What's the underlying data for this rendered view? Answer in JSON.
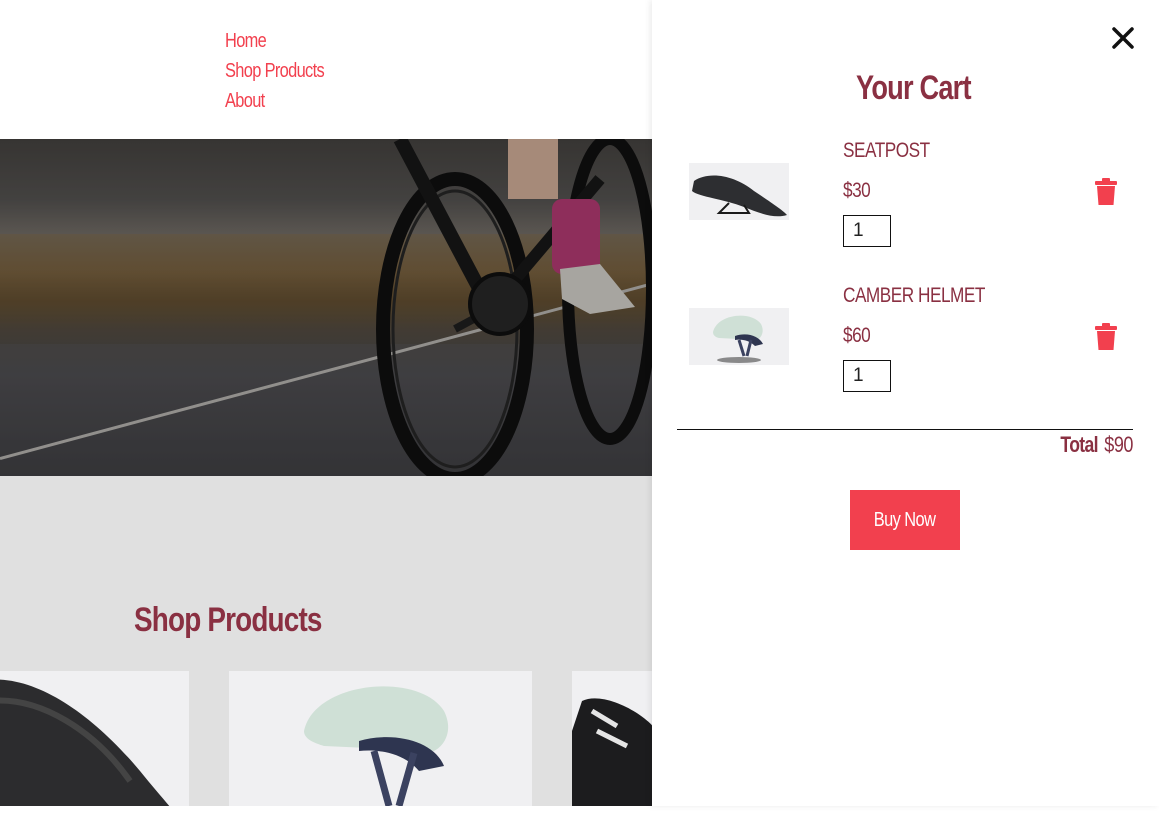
{
  "nav": {
    "items": [
      {
        "label": "Home"
      },
      {
        "label": "Shop Products"
      },
      {
        "label": "About"
      }
    ]
  },
  "shop": {
    "title": "Shop Products"
  },
  "cart": {
    "title": "Your Cart",
    "items": [
      {
        "name": "SEATPOST",
        "price": "$30",
        "quantity": "1",
        "thumbnail": "saddle-image"
      },
      {
        "name": "CAMBER HELMET",
        "price": "$60",
        "quantity": "1",
        "thumbnail": "helmet-image"
      }
    ],
    "total_label": "Total",
    "total_value": "$90",
    "buy_label": "Buy Now"
  },
  "colors": {
    "accent": "#f2404e",
    "heading": "#8a3042",
    "section_bg": "#e0e0e0"
  }
}
